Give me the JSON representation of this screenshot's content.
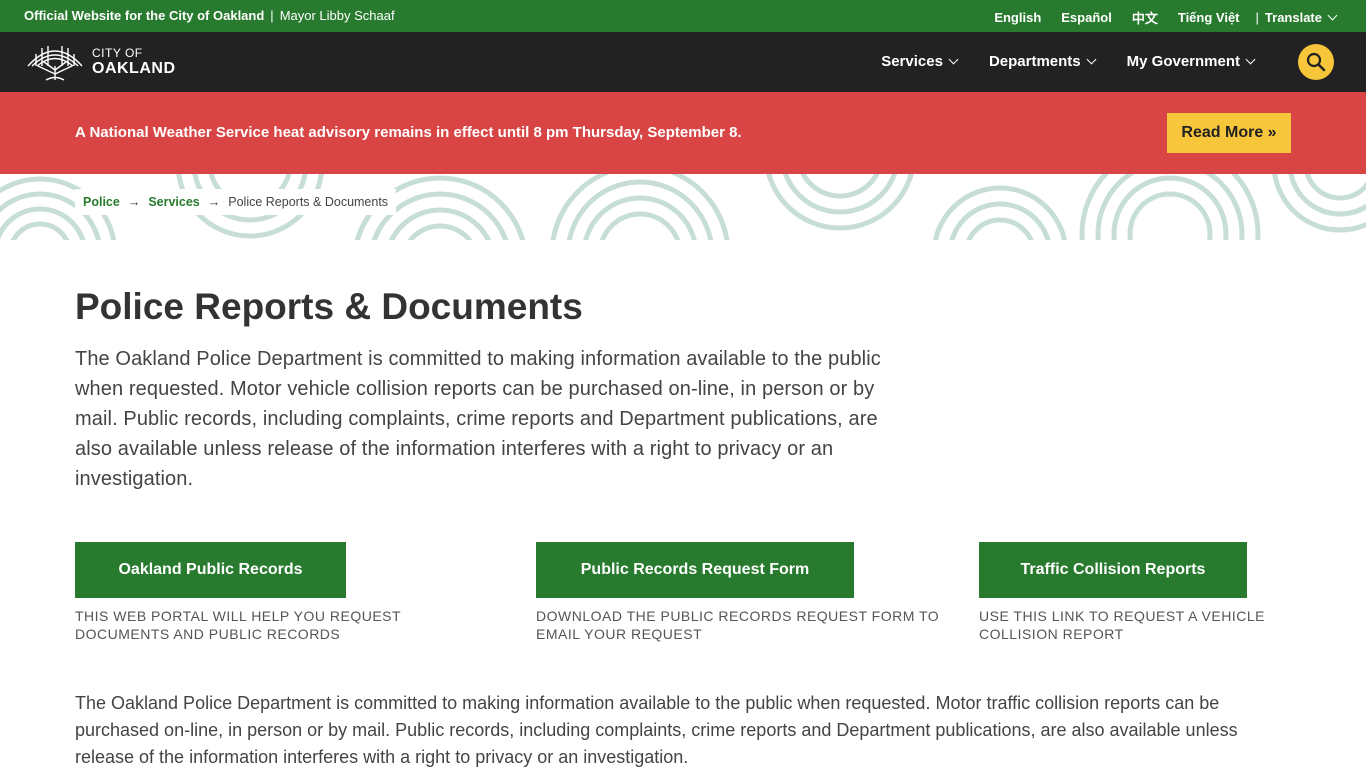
{
  "topbar": {
    "official": "Official Website for the City of Oakland",
    "separator": "|",
    "mayor": "Mayor Libby Schaaf",
    "languages": [
      "English",
      "Español",
      "中文",
      "Tiếng Việt"
    ],
    "translate": "Translate"
  },
  "nav": {
    "logo_city_of": "CITY OF",
    "logo_oakland": "OAKLAND",
    "menu": [
      "Services",
      "Departments",
      "My Government"
    ]
  },
  "alert": {
    "message": "A National Weather Service heat advisory remains in effect until 8 pm Thursday, September 8.",
    "read_more": "Read More »"
  },
  "breadcrumb": {
    "items": [
      "Police",
      "Services"
    ],
    "arrow": "→",
    "current": "Police Reports & Documents"
  },
  "page": {
    "title": "Police Reports & Documents",
    "intro": "The Oakland Police Department is committed to making information available to the public when requested. Motor vehicle collision reports can be purchased on-line, in person or by mail. Public records, including complaints, crime reports and Department publications, are also available unless release of the information interferes with a right to privacy or an investigation.",
    "cards": [
      {
        "label": "Oakland Public Records",
        "description": "This web portal will help you request documents and public records"
      },
      {
        "label": "Public Records Request Form",
        "description": "Download the public records request form to email your request"
      },
      {
        "label": "Traffic Collision Reports",
        "description": "Use this link to request a vehicle collision report"
      }
    ],
    "body": "The Oakland Police Department is committed to making information available to the public when requested. Motor traffic collision reports can be purchased on-line, in person or by mail. Public records, including complaints, crime reports and Department publications, are also available unless release of the information interferes with a right to privacy or an investigation."
  },
  "colors": {
    "green": "#287b2e",
    "dark": "#222222",
    "alert_red": "#d94545",
    "yellow": "#f8c63a",
    "pattern": "#c6ded4"
  }
}
